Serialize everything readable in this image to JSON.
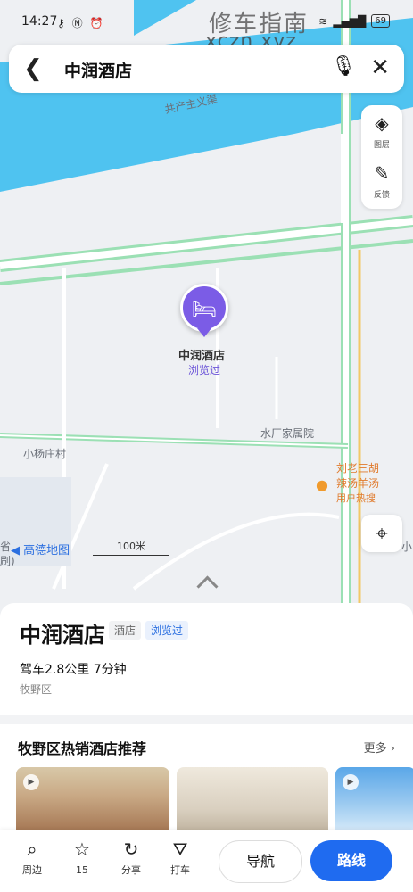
{
  "status_bar": {
    "time": "14:27",
    "battery": "69",
    "watermark_cn": "修车指南",
    "watermark_url": "xczn.xyz"
  },
  "search": {
    "title": "中润酒店"
  },
  "side_tools": [
    {
      "label": "图层",
      "icon": "layers-icon"
    },
    {
      "label": "反馈",
      "icon": "edit-icon"
    }
  ],
  "map": {
    "labels": {
      "road": "共产主义渠",
      "village": "小杨庄村",
      "compound": "水厂家属院",
      "poi_line1": "刘老三胡",
      "poi_line2": "辣汤羊汤",
      "poi_line3": "用户热搜",
      "left_edge": "省",
      "left_edge2": "刷)",
      "right_edge": "小"
    },
    "poi": {
      "name": "中润酒店",
      "sub": "浏览过"
    },
    "scale": "100米",
    "logo": "高德地图"
  },
  "sheet": {
    "hotel_name": "中润酒店",
    "tag_type": "酒店",
    "tag_viewed": "浏览过",
    "distance": "驾车2.8公里 7分钟",
    "district": "牧野区",
    "rec_title": "牧野区热销酒店推荐",
    "more": "更多"
  },
  "bottom_bar": {
    "items": [
      {
        "label": "周边",
        "icon": "search-icon"
      },
      {
        "label": "15",
        "icon": "star-icon"
      },
      {
        "label": "分享",
        "icon": "share-icon"
      },
      {
        "label": "打车",
        "icon": "taxi-icon"
      }
    ],
    "navigate": "导航",
    "route": "路线"
  },
  "colors": {
    "accent": "#1f6bf0",
    "poi": "#7b5ce6",
    "river": "#4fc3f0",
    "road_green": "#9be0b4"
  }
}
